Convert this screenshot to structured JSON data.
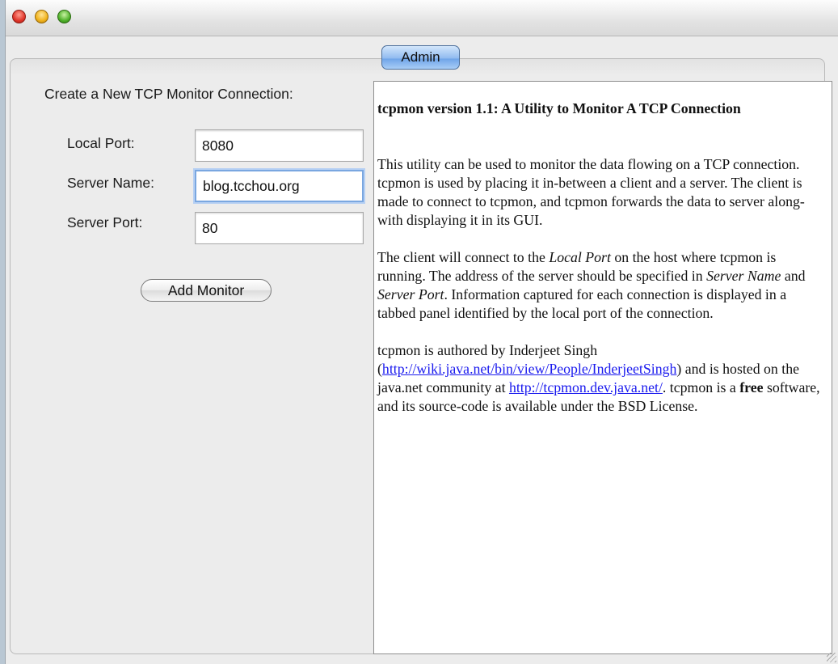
{
  "tabs": [
    {
      "label": "Admin",
      "selected": true
    }
  ],
  "form": {
    "title": "Create a New TCP Monitor Connection:",
    "local_port": {
      "label": "Local Port:",
      "value": "8080"
    },
    "server_name": {
      "label": "Server Name:",
      "value": "blog.tcchou.org"
    },
    "server_port": {
      "label": "Server Port:",
      "value": "80"
    },
    "add_button": "Add Monitor"
  },
  "info": {
    "heading": "tcpmon version 1.1: A Utility to Monitor A TCP Connection",
    "para1": "This utility can be used to monitor the data flowing on a TCP connection. tcpmon is used by placing it in-between a client and a server. The client is made to connect to tcpmon, and tcpmon forwards the data to server along-with displaying it in its GUI.",
    "para2": {
      "t1": "The client will connect to the ",
      "em1": "Local Port",
      "t2": " on the host where tcpmon is running. The address of the server should be specified in ",
      "em2": "Server Name",
      "t3": " and ",
      "em3": "Server Port",
      "t4": ". Information captured for each connection is displayed in a tabbed panel identified by the local port of the connection."
    },
    "para3": {
      "t1": "tcpmon is authored by Inderjeet Singh (",
      "link1": "http://wiki.java.net/bin/view/People/InderjeetSingh",
      "t2": ") and is hosted on the java.net community at ",
      "link2": "http://tcpmon.dev.java.net/",
      "t3": ". tcpmon is a ",
      "strong": "free",
      "t4": " software, and its source-code is available under the BSD License."
    }
  },
  "colors": {
    "tab_selected": "#8fbaf0",
    "link": "#1a1aee",
    "focus_ring": "#7aa7e0"
  }
}
